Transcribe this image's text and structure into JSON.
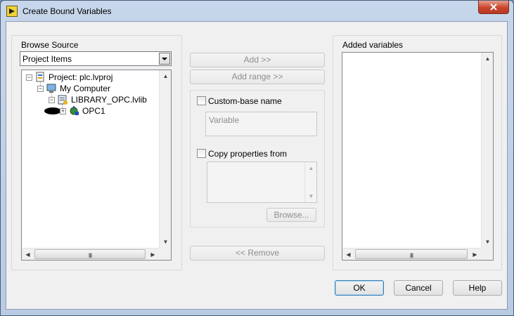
{
  "window": {
    "title": "Create Bound Variables"
  },
  "browse_source": {
    "label": "Browse Source",
    "selected": "Project Items",
    "tree": [
      {
        "label": "Project: plc.lvproj",
        "icon": "project-icon"
      },
      {
        "label": "My Computer",
        "icon": "computer-icon"
      },
      {
        "label": "LIBRARY_OPC.lvlib",
        "icon": "library-icon"
      },
      {
        "label": "OPC1",
        "icon": "io-server-icon"
      }
    ],
    "hscroll_grip": "III"
  },
  "middle": {
    "add_label": "Add >>",
    "add_range_label": "Add range >>",
    "custom_base_label": "Custom-base name",
    "custom_base_value": "Variable",
    "copy_properties_label": "Copy properties from",
    "browse_label": "Browse...",
    "remove_label": "<< Remove"
  },
  "added_variables": {
    "label": "Added variables",
    "hscroll_grip": "III"
  },
  "footer": {
    "ok_label": "OK",
    "cancel_label": "Cancel",
    "help_label": "Help"
  }
}
